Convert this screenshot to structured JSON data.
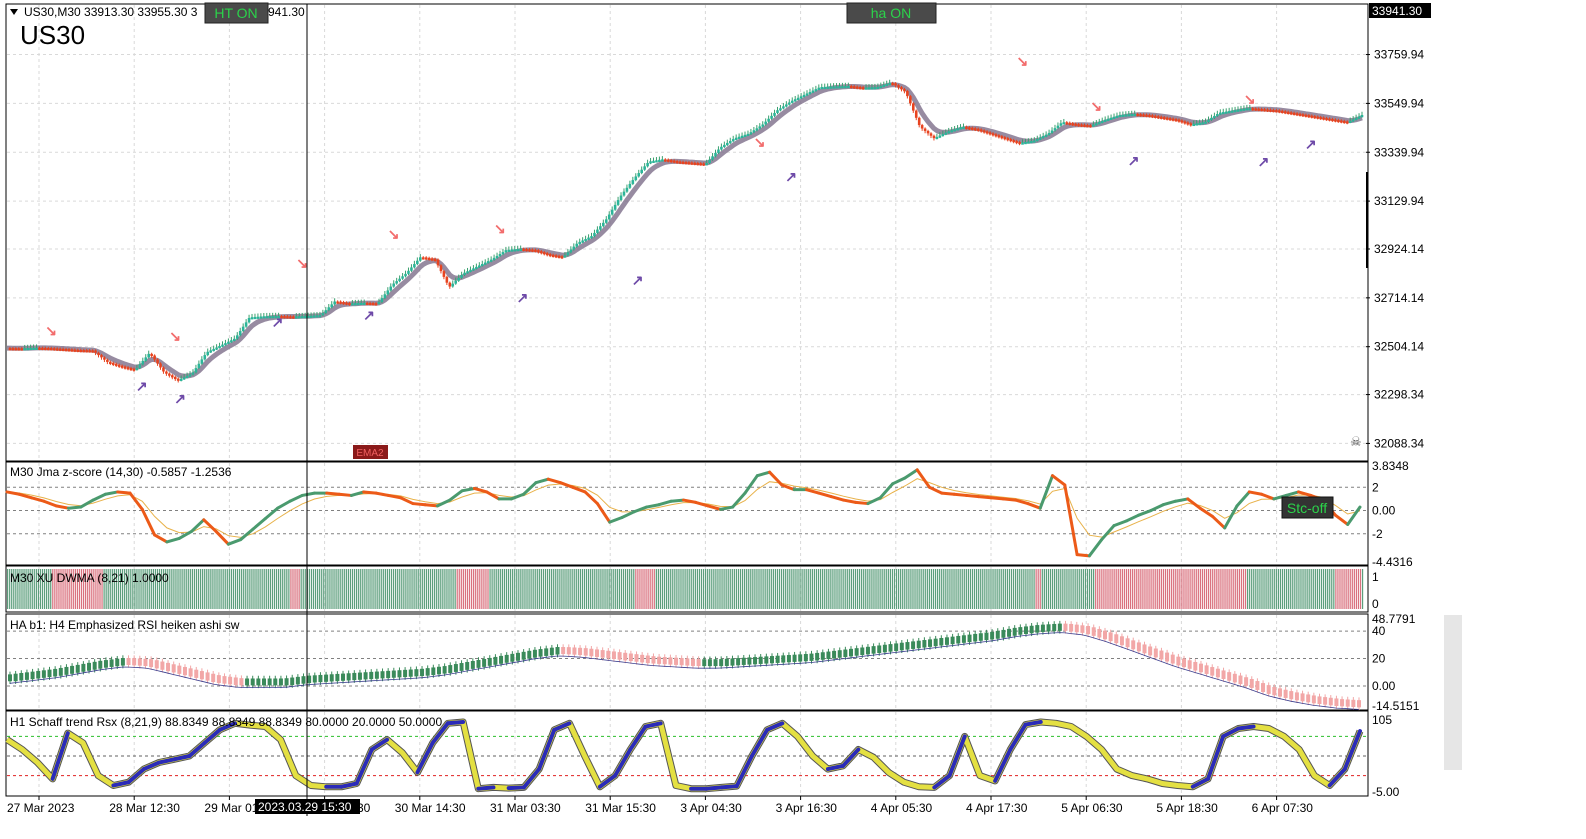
{
  "chart_data": [
    {
      "type": "line",
      "symbol": "US30",
      "header": "US30,M30  33913.30 33955.30 3",
      "header_tail": "941.30",
      "price_label": "33941.30",
      "badges": [
        "HT ON",
        "ha ON",
        "EMA2"
      ],
      "yticks": [
        "33759.94",
        "33549.94",
        "33339.94",
        "33129.94",
        "32924.14",
        "32714.14",
        "32504.14",
        "32298.34",
        "32088.34"
      ],
      "ylim": [
        32030,
        33960
      ],
      "x": [
        0,
        3,
        6,
        9,
        12,
        15,
        18,
        21,
        24,
        27,
        30,
        33,
        36,
        39,
        42,
        45,
        48,
        51,
        54,
        57,
        60,
        63,
        66,
        69,
        72,
        75,
        78,
        81,
        84,
        87,
        90,
        93,
        96,
        99,
        102,
        105,
        108,
        111,
        114,
        117,
        120,
        123,
        126,
        129,
        132,
        135,
        138,
        141,
        144,
        147,
        150,
        153,
        156,
        159,
        162,
        165,
        168,
        171,
        174,
        177,
        180,
        183,
        186,
        189,
        192,
        195,
        198,
        201,
        204,
        207,
        210,
        213,
        216,
        219,
        222,
        225,
        228,
        231,
        234,
        237,
        240,
        243,
        246,
        249,
        252,
        255,
        258,
        261,
        264,
        267,
        270,
        273,
        276,
        279,
        282,
        285
      ],
      "close": [
        32498,
        32497,
        32500,
        32498,
        32494,
        32490,
        32488,
        32440,
        32420,
        32405,
        32478,
        32395,
        32360,
        32390,
        32480,
        32510,
        32540,
        32630,
        32635,
        32636,
        32634,
        32636,
        32640,
        32700,
        32690,
        32693,
        32690,
        32770,
        32820,
        32890,
        32880,
        32760,
        32820,
        32850,
        32880,
        32920,
        32925,
        32920,
        32900,
        32890,
        32950,
        32980,
        33050,
        33150,
        33230,
        33300,
        33310,
        33300,
        33295,
        33290,
        33360,
        33400,
        33420,
        33460,
        33520,
        33560,
        33590,
        33620,
        33623,
        33625,
        33618,
        33620,
        33640,
        33600,
        33450,
        33400,
        33430,
        33450,
        33440,
        33420,
        33400,
        33380,
        33390,
        33420,
        33470,
        33460,
        33455,
        33480,
        33500,
        33505,
        33500,
        33490,
        33480,
        33460,
        33470,
        33510,
        33520,
        33530,
        33525,
        33520,
        33510,
        33500,
        33490,
        33480,
        33470,
        33500
      ]
    },
    {
      "type": "line",
      "title": "M30 Jma z-score (14,30) -0.5857 -1.2536",
      "badge": "Stc-off",
      "yticks": [
        "3.8348",
        "2",
        "0.00",
        "-2",
        "-4.4316"
      ],
      "ylim": [
        -4.4316,
        3.8348
      ],
      "levels": [
        2,
        0,
        -2
      ],
      "values": [
        1.6,
        1.4,
        1.1,
        0.8,
        0.4,
        0.2,
        0.3,
        0.9,
        1.4,
        1.6,
        1.5,
        0.1,
        -2.1,
        -2.7,
        -2.4,
        -1.8,
        -0.8,
        -1.8,
        -2.9,
        -2.5,
        -1.6,
        -0.7,
        0.2,
        0.8,
        1.3,
        1.5,
        1.5,
        1.4,
        1.3,
        1.6,
        1.5,
        1.3,
        1.1,
        0.6,
        0.5,
        0.4,
        0.9,
        1.7,
        1.9,
        1.6,
        1.0,
        1.0,
        1.4,
        2.4,
        2.7,
        2.4,
        2.0,
        1.6,
        0.6,
        -1.0,
        -0.6,
        -0.1,
        0.3,
        0.5,
        0.8,
        0.9,
        0.7,
        0.4,
        0.1,
        0.3,
        1.5,
        3.0,
        3.3,
        2.2,
        1.8,
        1.8,
        1.5,
        1.2,
        0.9,
        0.7,
        0.6,
        1.1,
        2.3,
        2.8,
        3.5,
        2.0,
        1.5,
        1.4,
        1.3,
        1.2,
        1.1,
        1.0,
        0.9,
        0.6,
        0.2,
        3.0,
        2.2,
        -3.8,
        -3.9,
        -2.5,
        -1.3,
        -0.9,
        -0.4,
        0.0,
        0.5,
        0.8,
        1.0,
        0.2,
        -0.5,
        -1.5,
        0.4,
        1.6,
        1.4,
        1.0,
        1.3,
        1.6,
        1.3,
        0.9,
        -0.4,
        -1.2,
        0.3
      ]
    },
    {
      "type": "bar",
      "title": "M30 XU DWMA (8,21) 1.0000",
      "yticks": [
        "1",
        "0"
      ],
      "states": "GGGGGGGGGGGGGGGGGGGGGGRRRRRRRRRRRRRRRRRRRRRRRRRGGGGGGGGGGGGGGGGGGGGGGGGGGGGGGGGGGGGGGGGGGGGGGGGGGGGGGGGGGGGGGGGGGGGGGGGGGGGGGGGGGGGGGGGGGGRRRRRGGGGGGGGGGGGGGGGGGGGGGGGGGGGGGGGGGGGGGGGGGGGGGGGGGGGGGGGGGGGGGGGGGGGGGGGGGGGRRRRRRRRRRRRRRRRGGGGGGGGGGGGGGGGGGGGGGGGGGGGGGGGGGGGGGGGGGGGGGGGGGGGGGGGGGGGGGGGGGGGGGGRRRRRRRRRRGGGGGGGGGGGGGGGGGGGGGGGGGGGGGGGGGGGGGGGGGGGGGGGGGGGGGGGGGGGGGGGGGGGGGGGGGGGGGGGGGGGGGGGGGGGGGGGGGGGGGGGGGGGGGGGGGGGGGGGGGGGGGGGGGGGGGGGGGGGGGGGGGGGGGGGGGGGGGGGGGGGGGGGGGGGGGGGGGGGGGGGGGRRRGGGGGGGGGGGGGGGGGGGGGGGGGGRRRRRRRRRRRRRRRRRRRRRRRRRRRRRRRRRRRRRRRRRRRRRRRRRRRRRRRRRRRRRRRRRRRRRRRRRRGGGGGGGGGGGGGGGGGGGGGGGGGGGGGGGGGGGGGGGGGGGRRRRRRRRRRRRRG"
    },
    {
      "type": "bar",
      "title": "HA b1: H4 Emphasized RSI heiken ashi sw",
      "yticks": [
        "48.7791",
        "40",
        "20",
        "0.00",
        "-14.5151"
      ],
      "ylim": [
        -14.5151,
        48.7791
      ],
      "levels": [
        40,
        20,
        0
      ],
      "up_color": "#3a8a5a",
      "down_color": "#f2a7a7",
      "values": [
        6,
        8,
        10,
        13,
        16,
        18,
        17,
        13,
        9,
        5,
        3,
        3,
        3,
        5,
        6,
        7,
        8,
        9,
        10,
        12,
        15,
        18,
        21,
        24,
        26,
        25,
        23,
        21,
        19,
        18,
        17,
        17,
        18,
        19,
        20,
        21,
        23,
        25,
        27,
        29,
        31,
        33,
        35,
        37,
        40,
        42,
        43,
        41,
        36,
        30,
        24,
        18,
        13,
        8,
        3,
        -3,
        -7,
        -10,
        -12,
        -13
      ]
    },
    {
      "type": "line",
      "title": "H1 Schaff trend Rsx (8,21,9) 88.8349 88.8349 88.8349 80.0000 20.0000 50.0000",
      "yticks": [
        "105",
        "-5.00"
      ],
      "ylim": [
        -5,
        105
      ],
      "levels": [
        80,
        50,
        20
      ],
      "values": [
        75,
        60,
        40,
        15,
        85,
        70,
        20,
        5,
        10,
        30,
        40,
        45,
        50,
        70,
        90,
        100,
        97,
        95,
        75,
        20,
        5,
        3,
        3,
        8,
        60,
        75,
        55,
        25,
        70,
        100,
        102,
        0,
        2,
        1,
        2,
        30,
        90,
        100,
        50,
        3,
        20,
        60,
        95,
        100,
        5,
        0,
        0,
        2,
        4,
        50,
        90,
        100,
        80,
        50,
        30,
        35,
        60,
        48,
        25,
        10,
        3,
        2,
        20,
        80,
        20,
        12,
        60,
        98,
        102,
        100,
        95,
        80,
        60,
        30,
        20,
        15,
        8,
        5,
        3,
        15,
        80,
        92,
        95,
        92,
        80,
        60,
        20,
        5,
        30,
        88
      ]
    }
  ],
  "xticks": [
    "27 Mar 2023",
    "28 Mar 12:30",
    "29 Mar 01:",
    "30 Mar 02:30",
    "30 Mar 14:30",
    "31 Mar 03:30",
    "31 Mar 15:30",
    "3 Apr 04:30",
    "3 Apr 16:30",
    "4 Apr 05:30",
    "4 Apr 17:30",
    "5 Apr 06:30",
    "5 Apr 18:30",
    "6 Apr 07:30"
  ],
  "crosshair_label": "2023.03.29 15:30",
  "colors": {
    "bull": "#2bb59a",
    "bear": "#e8431f",
    "wick_bull": "#3aa06e",
    "wick_bear": "#e8431f",
    "ema": "#7d6e8a",
    "arrow_down": "#f26c6c",
    "arrow_up": "#6e4aa8",
    "stc_line": "#2b2bb8",
    "stc_fill": "#e4e042",
    "xu_green": "#5c9e7c",
    "xu_red": "#d9707d"
  }
}
